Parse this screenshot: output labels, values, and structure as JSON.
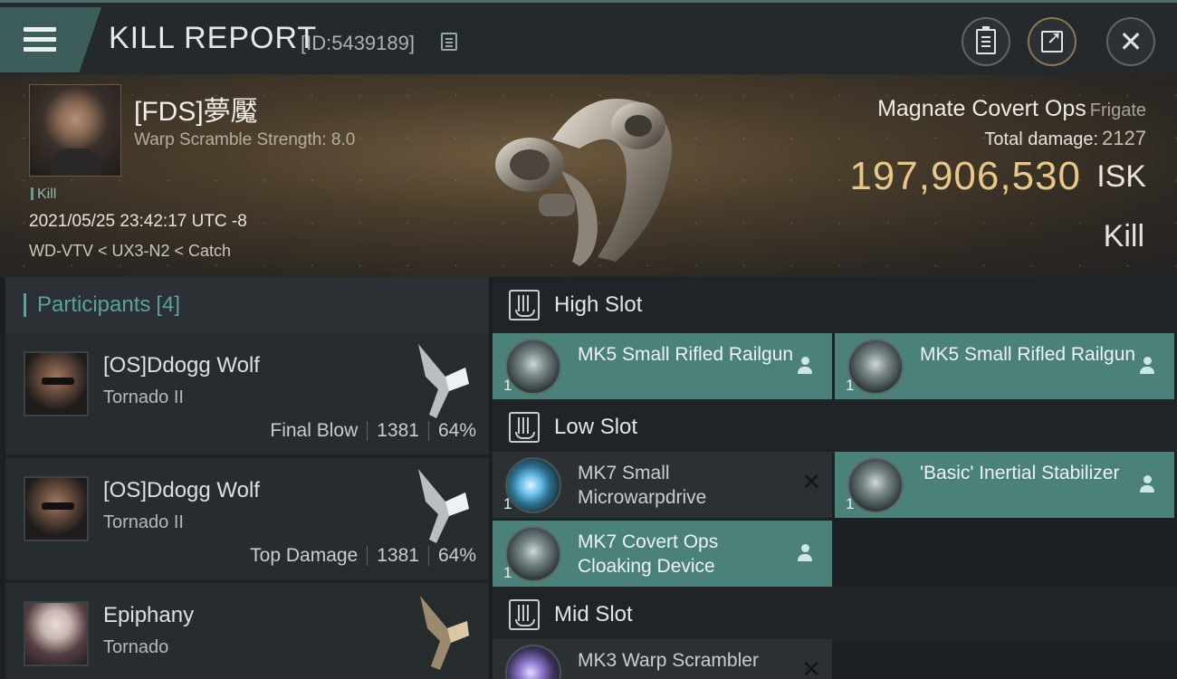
{
  "header": {
    "title": "KILL REPORT",
    "report_id": "[ID:5439189]"
  },
  "victim": {
    "name": "[FDS]夢魘",
    "detail": "Warp Scramble Strength: 8.0",
    "tag": "Kill",
    "datetime": "2021/05/25 23:42:17 UTC -8",
    "location": "WD-VTV < UX3-N2 < Catch"
  },
  "ship": {
    "name": "Magnate Covert Ops",
    "class": "Frigate",
    "total_damage_label": "Total damage:",
    "total_damage": "2127",
    "isk_value": "197,906,530",
    "isk_unit": "ISK",
    "result": "Kill"
  },
  "participants": {
    "label": "Participants",
    "count": "[4]",
    "items": [
      {
        "name": "[OS]Ddogg Wolf",
        "ship": "Tornado II",
        "role": "Final Blow",
        "damage": "1381",
        "percent": "64%"
      },
      {
        "name": "[OS]Ddogg Wolf",
        "ship": "Tornado II",
        "role": "Top Damage",
        "damage": "1381",
        "percent": "64%"
      },
      {
        "name": "Epiphany",
        "ship": "Tornado"
      }
    ]
  },
  "slots": {
    "high": {
      "title": "High Slot",
      "modules": [
        {
          "name": "MK5 Small Rifled Railgun",
          "qty": "1",
          "status": "person-icon"
        },
        {
          "name": "MK5 Small Rifled Railgun",
          "qty": "1",
          "status": "person-icon"
        }
      ]
    },
    "low": {
      "title": "Low Slot",
      "modules": [
        {
          "name": "MK7 Small Microwarpdrive",
          "qty": "1",
          "status": "close-icon"
        },
        {
          "name": "'Basic' Inertial Stabilizer",
          "qty": "1",
          "status": "person-icon"
        },
        {
          "name": "MK7 Covert Ops Cloaking Device",
          "qty": "1",
          "status": "person-icon"
        }
      ]
    },
    "mid": {
      "title": "Mid Slot",
      "modules": [
        {
          "name": "MK3 Warp Scrambler",
          "qty": "1",
          "status": "close-icon"
        }
      ]
    }
  },
  "colors": {
    "accent_teal": "#4a8178",
    "isk_gold": "#e8c888",
    "participants_label": "#58a39a"
  }
}
